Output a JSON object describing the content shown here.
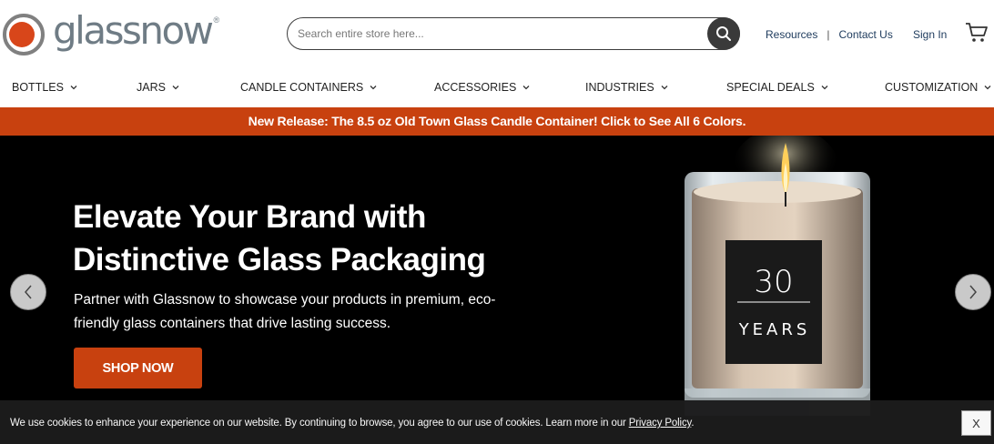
{
  "brand": {
    "name": "glassnow",
    "trademark": "®",
    "logo_colors": {
      "ring": "#808080",
      "dot": "#d8461a"
    }
  },
  "search": {
    "placeholder": "Search entire store here..."
  },
  "top_links": {
    "resources": "Resources",
    "separator": "|",
    "contact": "Contact Us",
    "sign_in": "Sign In"
  },
  "nav": {
    "items": [
      {
        "label": "BOTTLES"
      },
      {
        "label": "JARS"
      },
      {
        "label": "CANDLE CONTAINERS"
      },
      {
        "label": "ACCESSORIES"
      },
      {
        "label": "INDUSTRIES"
      },
      {
        "label": "SPECIAL DEALS"
      },
      {
        "label": "CUSTOMIZATION"
      }
    ]
  },
  "promo": {
    "text": "New Release: The 8.5 oz Old Town Glass Candle Container! Click to See All 6 Colors.",
    "color": "#c8410f"
  },
  "hero": {
    "title_line1": "Elevate Your Brand with",
    "title_line2": "Distinctive Glass Packaging",
    "subtitle_line1": "Partner with Glassnow to showcase your products in premium, eco-",
    "subtitle_line2": "friendly glass containers that drive lasting success.",
    "cta": "SHOP NOW",
    "label_number": "30",
    "label_word": "YEARS",
    "accent": "#c8410f"
  },
  "cookie": {
    "text": "We use cookies to enhance your experience on our website. By continuing to browse, you agree to our use of cookies. Learn more in our ",
    "link": "Privacy Policy",
    "suffix": ".",
    "close": "X"
  }
}
